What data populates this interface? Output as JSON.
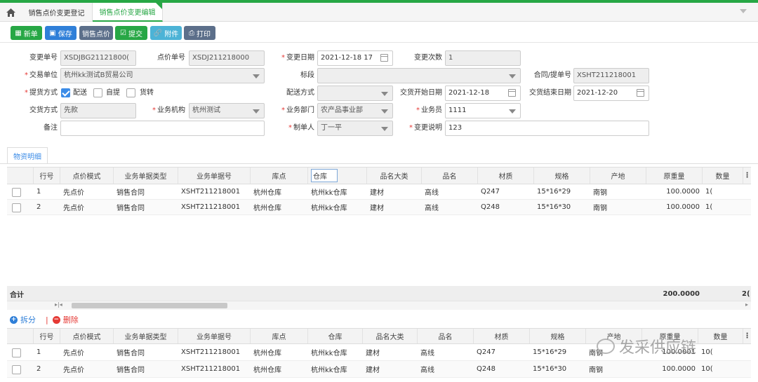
{
  "tabs": [
    {
      "label": "销售点价变更登记"
    },
    {
      "label": "销售点价变更编辑"
    }
  ],
  "toolbar": {
    "new_label": "新单",
    "save_label": "保存",
    "price_label": "销售点价",
    "submit_label": "提交",
    "attach_label": "附件",
    "print_label": "打印"
  },
  "form": {
    "change_no_label": "变更单号",
    "change_no": "XSDJBG21121800(",
    "price_no_label": "点价单号",
    "price_no": "XSDJ211218000",
    "change_date_label": "变更日期",
    "change_date": "2021-12-18 17",
    "change_count_label": "变更次数",
    "change_count": "1",
    "trade_unit_label": "交易单位",
    "trade_unit": "杭州kk测试B贸易公司",
    "segment_label": "标段",
    "segment": "",
    "contract_label": "合同/提单号",
    "contract": "XSHT211218001",
    "delivery_label": "提货方式",
    "opt_delivery": "配送",
    "opt_pickup": "自提",
    "opt_transfer": "货转",
    "ship_method_label": "配送方式",
    "ship_method": "",
    "start_date_label": "交货开始日期",
    "start_date": "2021-12-18",
    "end_date_label": "交货结束日期",
    "end_date": "2021-12-20",
    "pay_label": "交货方式",
    "pay": "先款",
    "org_label": "业务机构",
    "org": "杭州测试",
    "dept_label": "业务部门",
    "dept": "农产品事业部",
    "salesman_label": "业务员",
    "salesman": "1111",
    "remark_label": "备注",
    "remark": "",
    "maker_label": "制单人",
    "maker": "丁一平",
    "change_desc_label": "变更说明",
    "change_desc": "123"
  },
  "section_tab": "物资明细",
  "grid1": {
    "headers": [
      "行号",
      "点价模式",
      "业务单据类型",
      "业务单据号",
      "库点",
      "仓库",
      "品名大类",
      "品名",
      "材质",
      "规格",
      "产地",
      "原重量",
      "数量"
    ],
    "rows": [
      [
        "1",
        "先点价",
        "销售合同",
        "XSHT211218001",
        "杭州仓库",
        "杭州kk仓库",
        "建材",
        "高线",
        "Q247",
        "15*16*29",
        "南钢",
        "100.0000",
        "1("
      ],
      [
        "2",
        "先点价",
        "销售合同",
        "XSHT211218001",
        "杭州仓库",
        "杭州kk仓库",
        "建材",
        "高线",
        "Q248",
        "15*16*30",
        "南钢",
        "100.0000",
        "1("
      ]
    ],
    "sum_label": "合计",
    "sum_weight": "200.0000",
    "sum_qty": "2("
  },
  "detail_actions": {
    "split_label": "拆分",
    "delete_label": "删除"
  },
  "grid2": {
    "headers": [
      "行号",
      "点价模式",
      "业务单据类型",
      "业务单据号",
      "库点",
      "仓库",
      "品名大类",
      "品名",
      "材质",
      "规格",
      "产地",
      "原重量",
      "数量"
    ],
    "rows": [
      [
        "1",
        "先点价",
        "销售合同",
        "XSHT211218001",
        "杭州仓库",
        "杭州kk仓库",
        "建材",
        "高线",
        "Q247",
        "15*16*29",
        "南钢",
        "100.0001",
        "10("
      ],
      [
        "2",
        "先点价",
        "销售合同",
        "XSHT211218001",
        "杭州仓库",
        "杭州kk仓库",
        "建材",
        "高线",
        "Q248",
        "15*16*30",
        "南钢",
        "100.0000",
        "10("
      ]
    ]
  },
  "watermark": "发采供应链",
  "colors": {
    "brand_green": "#27a745",
    "primary_blue": "#2f7fd8",
    "danger_red": "#e53935"
  }
}
